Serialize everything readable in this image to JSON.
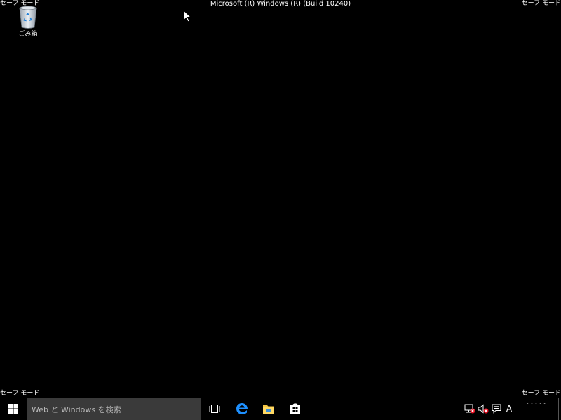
{
  "desktop": {
    "background": "#000000",
    "safe_mode_label": "セーフ モード",
    "build_label": "Microsoft (R) Windows (R) (Build 10240)",
    "icons": [
      {
        "label": "ごみ箱",
        "icon": "recycle-bin-icon"
      }
    ]
  },
  "taskbar": {
    "start_icon": "windows-logo-icon",
    "search": {
      "placeholder": "Web と Windows を検索"
    },
    "apps": [
      {
        "icon": "task-view-icon"
      },
      {
        "icon": "edge-icon",
        "color": "#1e90ff"
      },
      {
        "icon": "file-explorer-icon",
        "color": "#f4c542"
      },
      {
        "icon": "store-icon"
      }
    ],
    "tray": {
      "icons": [
        "network-error-icon",
        "volume-muted-icon",
        "action-center-icon"
      ],
      "ime_label": "A",
      "clock_time": "- - - - -",
      "clock_date": "- - - - - - - -"
    }
  }
}
